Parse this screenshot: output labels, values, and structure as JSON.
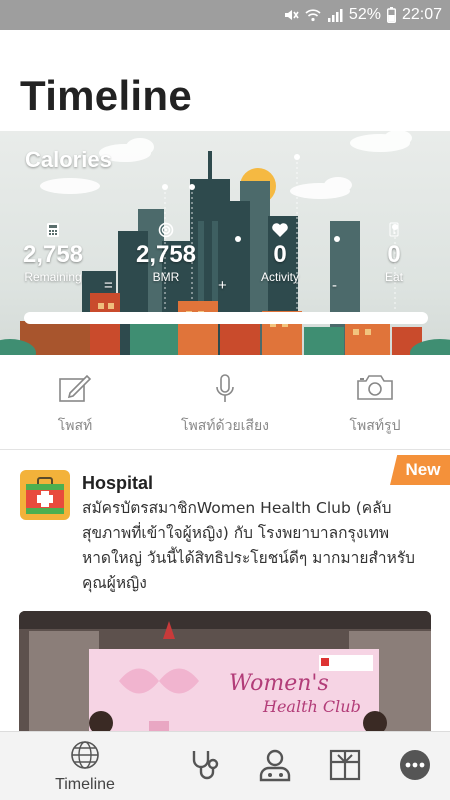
{
  "status_bar": {
    "battery": "52%",
    "time": "22:07"
  },
  "header": {
    "title": "Timeline"
  },
  "calories": {
    "title": "Calories",
    "remaining": {
      "value": "2,758",
      "label": "Remaining"
    },
    "bmr": {
      "value": "2,758",
      "label": "BMR"
    },
    "activity": {
      "value": "0",
      "label": "Activity"
    },
    "eat": {
      "value": "0",
      "label": "Eat"
    },
    "operators": {
      "equals": "=",
      "plus": "+",
      "minus": "-"
    },
    "progress_fraction": 1.0
  },
  "actions": [
    {
      "label": "โพสท์",
      "icon": "edit-icon"
    },
    {
      "label": "โพสท์ด้วยเสียง",
      "icon": "microphone-icon"
    },
    {
      "label": "โพสท์รูป",
      "icon": "camera-icon"
    }
  ],
  "feed": {
    "badge": "New",
    "title": "Hospital",
    "text": "สมัครบัตรสมาชิกWomen Health Club (คลับสุขภาพที่เข้าใจผู้หญิง) กับ โรงพยาบาลกรุงเทพหาดใหญ่ วันนี้ได้สิทธิประโยชน์ดีๆ มากมายสำหรับคุณผู้หญิง",
    "image_text_line1": "Women's",
    "image_text_line2": "Health Club"
  },
  "bottom_nav": {
    "items": [
      {
        "label": "Timeline",
        "icon": "globe-icon"
      },
      {
        "label": "",
        "icon": "stethoscope-icon"
      },
      {
        "label": "",
        "icon": "doctor-icon"
      },
      {
        "label": "",
        "icon": "gift-icon"
      },
      {
        "label": "",
        "icon": "more-icon"
      }
    ]
  },
  "colors": {
    "accent": "#f4913a",
    "status_bar": "#9e9e9e"
  }
}
